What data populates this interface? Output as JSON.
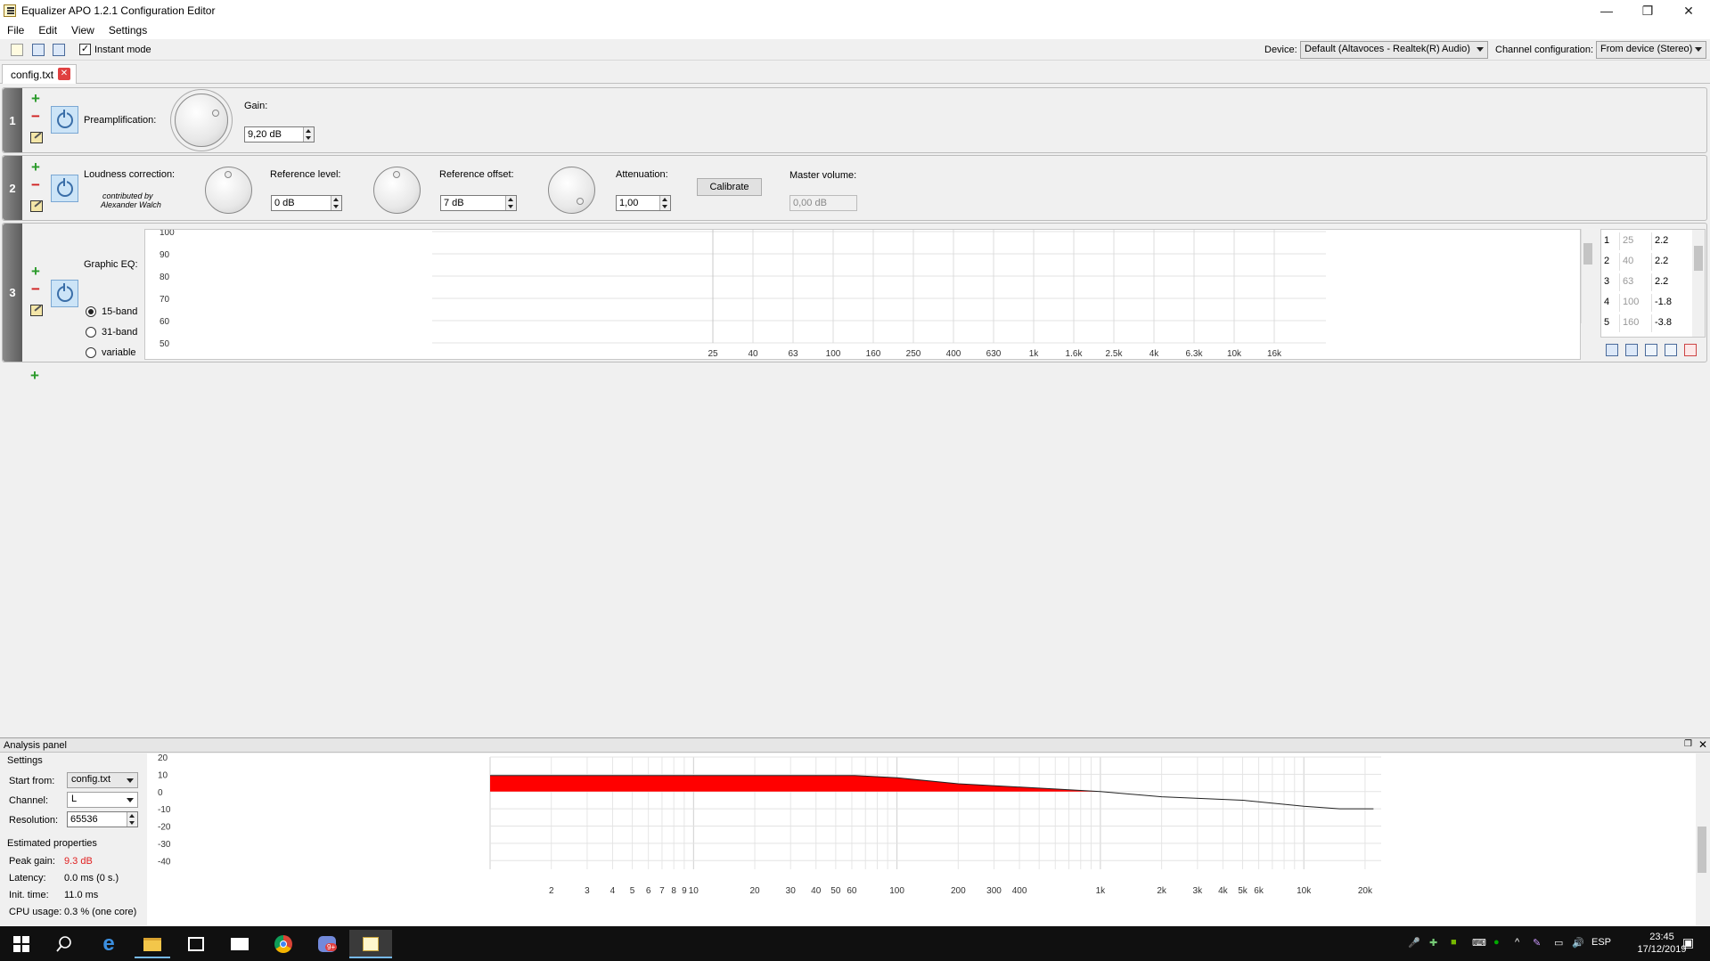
{
  "window": {
    "title": "Equalizer APO 1.2.1 Configuration Editor",
    "minimize": "—",
    "maximize": "❐",
    "close": "✕"
  },
  "menu": [
    "File",
    "Edit",
    "View",
    "Settings"
  ],
  "toolbar": {
    "instant_mode": "Instant mode",
    "instant_mode_checked": true,
    "device_label": "Device:",
    "device_value": "Default (Altavoces - Realtek(R) Audio)",
    "channel_label": "Channel configuration:",
    "channel_value": "From device (Stereo)"
  },
  "tab": {
    "label": "config.txt"
  },
  "filters": {
    "f1": {
      "num": "1",
      "label": "Preamplification:",
      "gain_label": "Gain:",
      "gain_value": "9,20 dB"
    },
    "f2": {
      "num": "2",
      "label": "Loudness correction:",
      "credit1": "contributed by",
      "credit2": "Alexander Walch",
      "ref_level_label": "Reference level:",
      "ref_level_value": "0 dB",
      "ref_offset_label": "Reference offset:",
      "ref_offset_value": "7 dB",
      "atten_label": "Attenuation:",
      "atten_value": "1,00",
      "calibrate": "Calibrate",
      "master_label": "Master volume:",
      "master_value": "0,00 dB"
    },
    "f3": {
      "num": "3",
      "label": "Graphic EQ:",
      "modes": [
        "15-band",
        "31-band",
        "variable"
      ],
      "selected_mode": "15-band"
    }
  },
  "chart_data": [
    {
      "type": "line",
      "yticks": [
        "100",
        "90",
        "80",
        "70",
        "60",
        "50"
      ],
      "xticks": [
        "25",
        "40",
        "63",
        "100",
        "160",
        "250",
        "400",
        "630",
        "1k",
        "1.6k",
        "2.5k",
        "4k",
        "6.3k",
        "10k",
        "16k"
      ],
      "bands_table": [
        {
          "n": "1",
          "freq": "25",
          "gain": "2.2"
        },
        {
          "n": "2",
          "freq": "40",
          "gain": "2.2"
        },
        {
          "n": "3",
          "freq": "63",
          "gain": "2.2"
        },
        {
          "n": "4",
          "freq": "100",
          "gain": "-1.8"
        },
        {
          "n": "5",
          "freq": "160",
          "gain": "-3.8"
        }
      ]
    },
    {
      "type": "area",
      "yticks": [
        "20",
        "10",
        "0",
        "-10",
        "-20",
        "-30",
        "-40"
      ],
      "ylim": [
        -45,
        20
      ],
      "xticks": [
        "2",
        "3",
        "4",
        "5",
        "6",
        "7",
        "8",
        "9",
        "10",
        "20",
        "30",
        "40",
        "50",
        "60",
        "100",
        "200",
        "300",
        "400",
        "1k",
        "2k",
        "3k",
        "4k",
        "5k",
        "6k",
        "10k",
        "20k"
      ],
      "x": [
        1,
        20,
        62,
        100,
        200,
        600,
        1000,
        2000,
        5000,
        10000,
        15000,
        22000
      ],
      "y": [
        9.3,
        9.3,
        9.3,
        8.0,
        4.5,
        1.5,
        0,
        -3.0,
        -5.0,
        -8.5,
        -10.0,
        -10.0
      ],
      "color": "#ff0000"
    }
  ],
  "analysis": {
    "title": "Analysis panel",
    "settings": "Settings",
    "start_from_label": "Start from:",
    "start_from_value": "config.txt",
    "channel_label": "Channel:",
    "channel_value": "L",
    "resolution_label": "Resolution:",
    "resolution_value": "65536",
    "est": "Estimated properties",
    "peak_label": "Peak gain:",
    "peak_value": "9.3 dB",
    "latency_label": "Latency:",
    "latency_value": "0.0 ms (0 s.)",
    "init_label": "Init. time:",
    "init_value": "11.0 ms",
    "cpu_label": "CPU usage:",
    "cpu_value": "0.3 % (one core)"
  },
  "taskbar": {
    "lang": "ESP",
    "time": "23:45",
    "date": "17/12/2019",
    "badge": "9+"
  }
}
